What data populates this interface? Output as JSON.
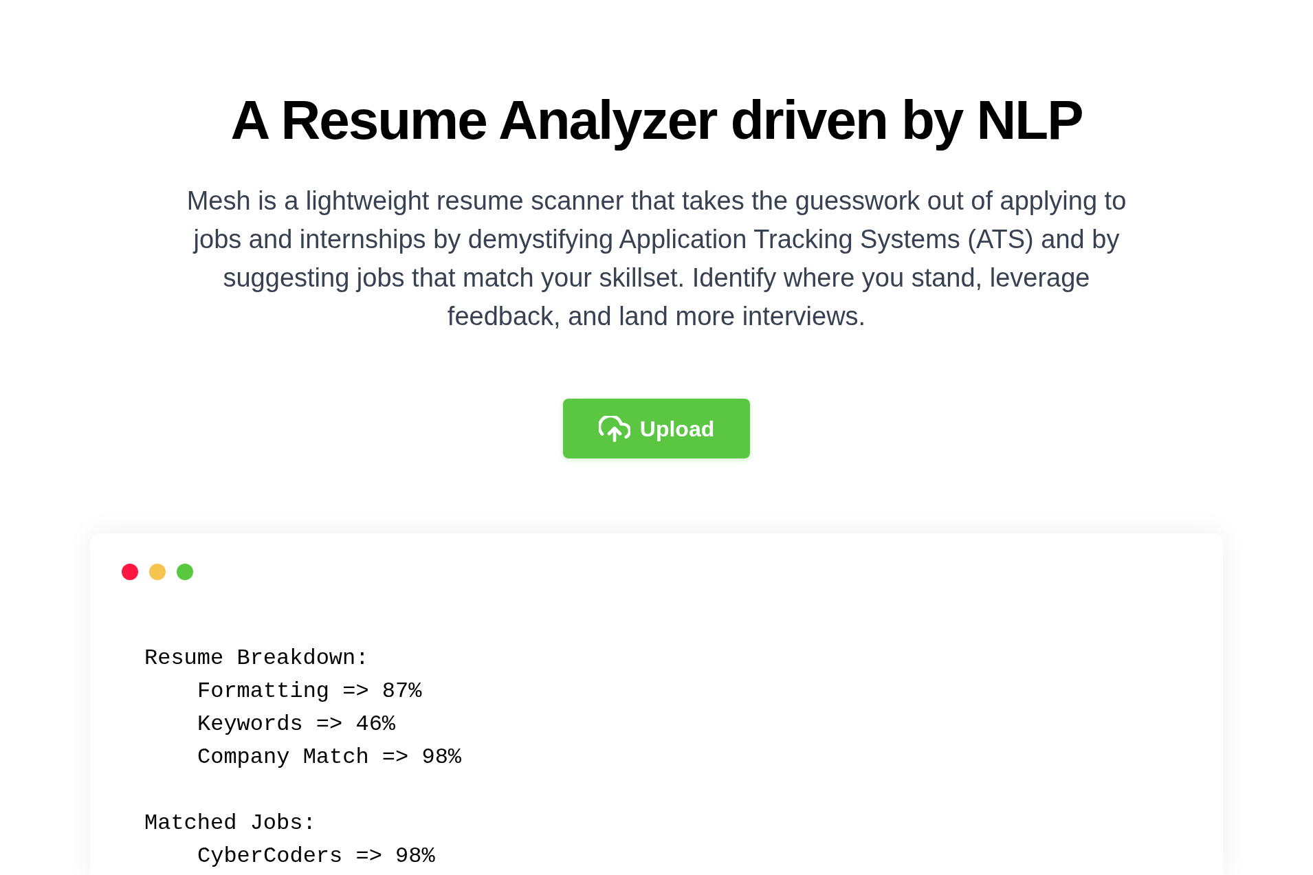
{
  "heading": "A Resume Analyzer driven by NLP",
  "description": "Mesh is a lightweight resume scanner that takes the guesswork out of applying to jobs and internships by demystifying Application Tracking Systems (ATS) and by suggesting jobs that match your skillset. Identify where you stand, leverage feedback, and land more interviews.",
  "upload_button": {
    "label": "Upload"
  },
  "terminal": {
    "window_dots": [
      {
        "color": "#ff1744"
      },
      {
        "color": "#f8c450"
      },
      {
        "color": "#5ac83f"
      }
    ],
    "sections": [
      {
        "title": "Resume Breakdown:",
        "lines": [
          "Formatting => 87%",
          "Keywords => 46%",
          "Company Match => 98%"
        ]
      },
      {
        "title": "Matched Jobs:",
        "lines": [
          "CyberCoders => 98%"
        ]
      }
    ]
  }
}
